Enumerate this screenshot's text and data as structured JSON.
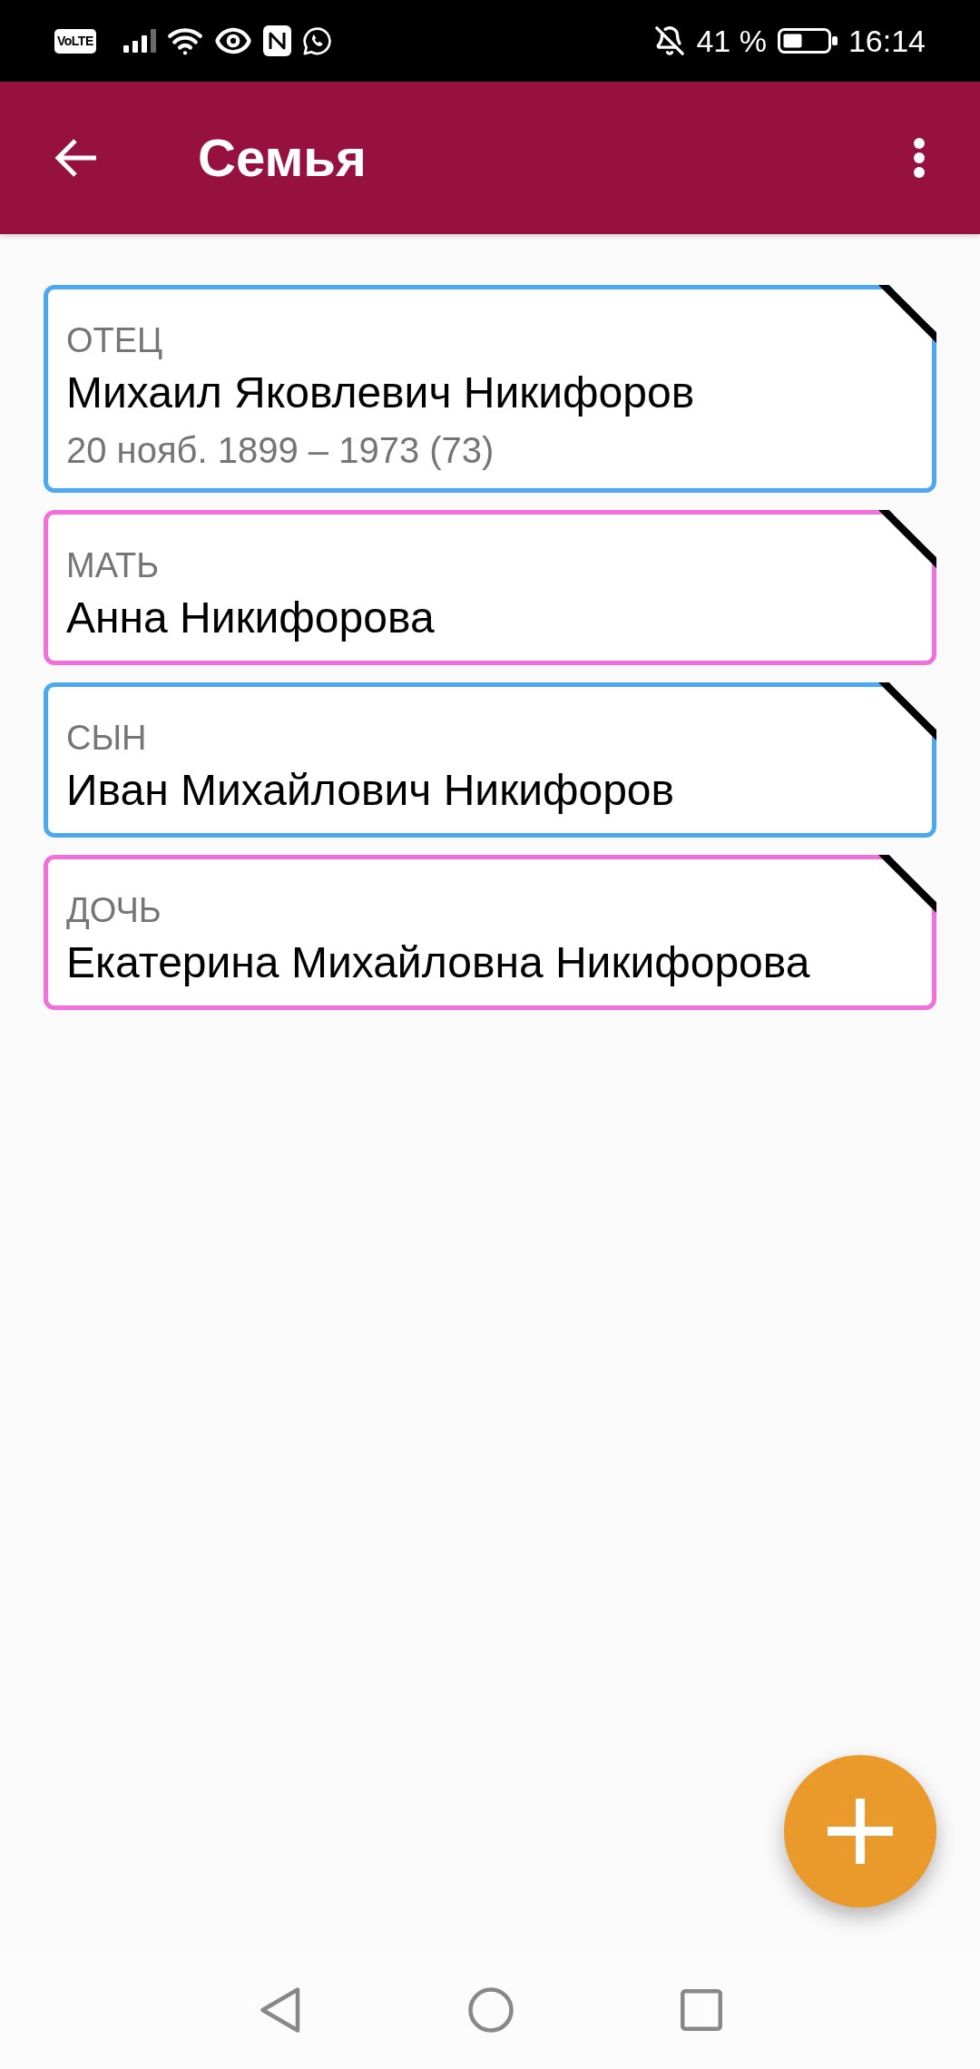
{
  "status_bar": {
    "volte_badge": "VoLTE",
    "battery_percent": "41 %",
    "time": "16:14"
  },
  "app_bar": {
    "title": "Семья"
  },
  "members": [
    {
      "relation": "ОТЕЦ",
      "name": "Михаил Яковлевич Никифоров",
      "dates": "20 нояб. 1899 – 1973 (73)",
      "color": "#4ca9f1",
      "ribbon": true
    },
    {
      "relation": "МАТЬ",
      "name": "Анна Никифорова",
      "color": "#f270dc",
      "ribbon": true
    },
    {
      "relation": "СЫН",
      "name": "Иван Михайлович Никифоров",
      "color": "#4ca9f1",
      "ribbon": true
    },
    {
      "relation": "ДОЧЬ",
      "name": "Екатерина Михайловна Никифорова",
      "color": "#f270dc",
      "ribbon": true
    }
  ]
}
